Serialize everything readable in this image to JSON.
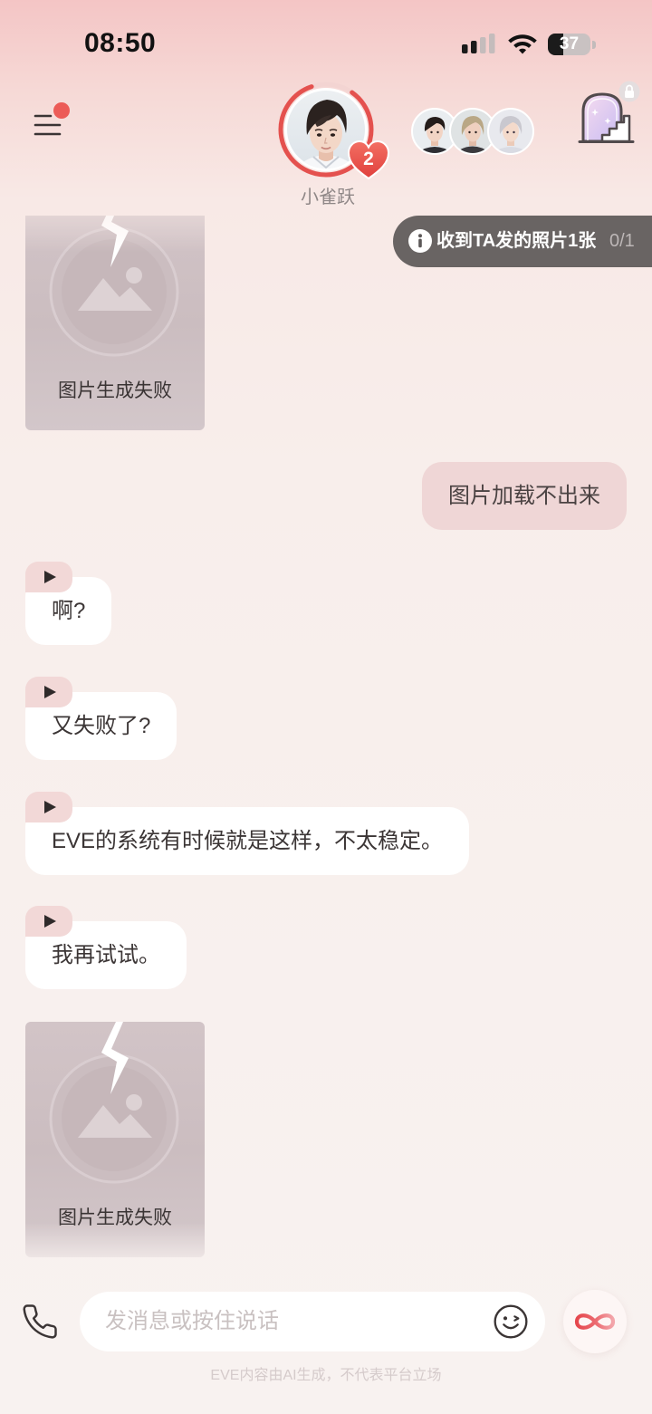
{
  "status_bar": {
    "time": "08:50",
    "battery": "37",
    "battery_level": 0.37
  },
  "header": {
    "menu_icon": "menu-icon",
    "menu_has_badge": true,
    "contact": {
      "name": "小雀跃",
      "hearts": "2",
      "ring_progress": 0.85
    },
    "other_avatars": [
      "dark-hair-boy-avatar",
      "blonde-hair-man-avatar",
      "silver-hair-boy-avatar"
    ],
    "scene_icon": "arch-door-stairs-icon",
    "scene_locked": true
  },
  "photo_notice": {
    "icon": "info-icon",
    "text": "收到TA发的照片1张",
    "count": "0/1"
  },
  "messages": [
    {
      "from_user": false,
      "image_failed": true,
      "text": "图片生成失败"
    },
    {
      "from_user": true,
      "text": "图片加载不出来"
    },
    {
      "from_user": false,
      "has_voice": true,
      "text": "啊?"
    },
    {
      "from_user": false,
      "has_voice": true,
      "text": "又失败了?"
    },
    {
      "from_user": false,
      "has_voice": true,
      "text": "EVE的系统有时候就是这样，不太稳定。"
    },
    {
      "from_user": false,
      "has_voice": true,
      "text": "我再试试。"
    },
    {
      "from_user": false,
      "image_failed": true,
      "text": "图片生成失败"
    }
  ],
  "composer": {
    "call_icon": "phone-icon",
    "placeholder": "发消息或按住说话",
    "emoji_icon": "wink-emoji-icon",
    "action_icon": "infinity-icon"
  },
  "footer": {
    "disclaimer": "EVE内容由AI生成，不代表平台立场"
  },
  "colors": {
    "accent": "#e4514e",
    "badge": "#ec5b57",
    "user_bubble": "#efd6d6",
    "voice_tag": "#f2d8d7",
    "notice_bg": "#5c5858"
  }
}
